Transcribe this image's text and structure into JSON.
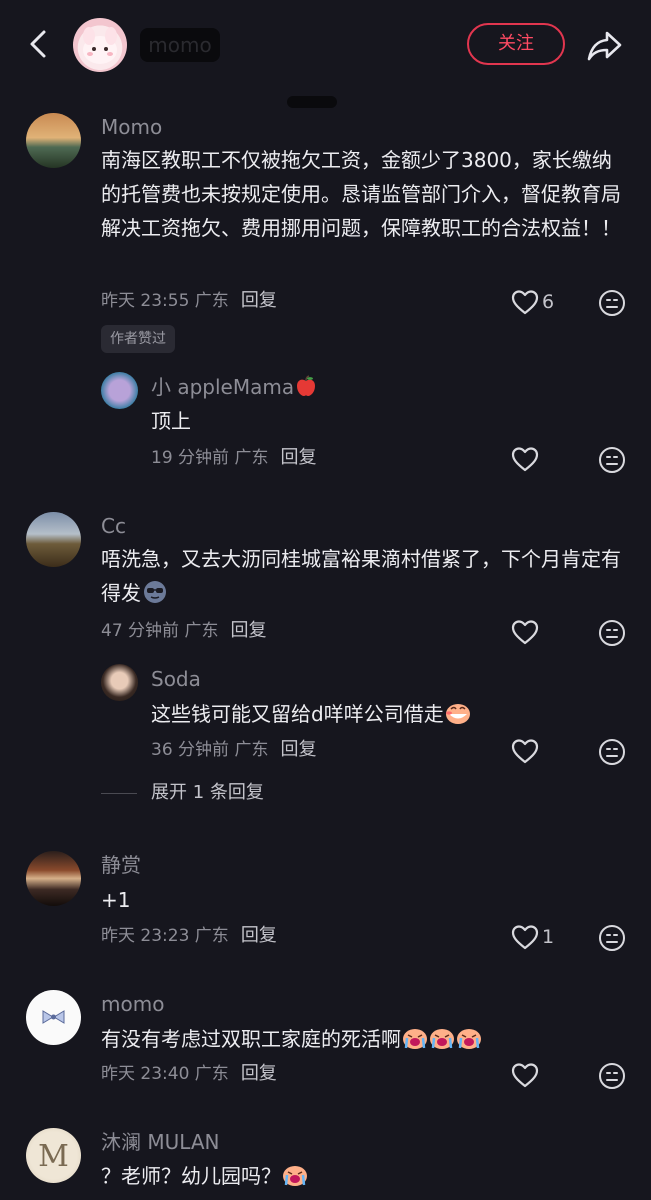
{
  "header": {
    "username": "momo",
    "follow_label": "关注"
  },
  "comments": [
    {
      "user": "Momo",
      "text": "南海区教职工不仅被拖欠工资，金额少了3800，家长缴纳的托管费也未按规定使用。恳请监管部门介入，督促教育局解决工资拖欠、费用挪用问题，保障教职工的合法权益！！",
      "time": "昨天 23:55 广东",
      "reply": "回复",
      "likes": "6",
      "badge": "作者赞过"
    },
    {
      "user": "小 appleMama",
      "text": "顶上",
      "time": "19 分钟前 广东",
      "reply": "回复"
    },
    {
      "user": "Cc",
      "text": "唔洗急，又去大沥同桂城富裕果滴村借紧了，下个月肯定有得发",
      "time": "47 分钟前 广东",
      "reply": "回复"
    },
    {
      "user": "Soda",
      "text": "这些钱可能又留给d咩咩公司借走",
      "time": "36 分钟前 广东",
      "reply": "回复"
    },
    {
      "user": "静赏",
      "text": "+1",
      "time": "昨天 23:23 广东",
      "reply": "回复",
      "likes": "1"
    },
    {
      "user": "momo",
      "text": "有没有考虑过双职工家庭的死活啊",
      "time": "昨天 23:40 广东",
      "reply": "回复"
    },
    {
      "user": "沐澜 MULAN",
      "text": "？老师？幼儿园吗？"
    }
  ],
  "expand_replies": "展开 1 条回复",
  "icons": [
    "back-icon",
    "share-icon",
    "heart-icon",
    "comment-face-icon",
    "apple-emoji",
    "sunglasses-emoji",
    "grin-emoji",
    "crying-emoji"
  ]
}
